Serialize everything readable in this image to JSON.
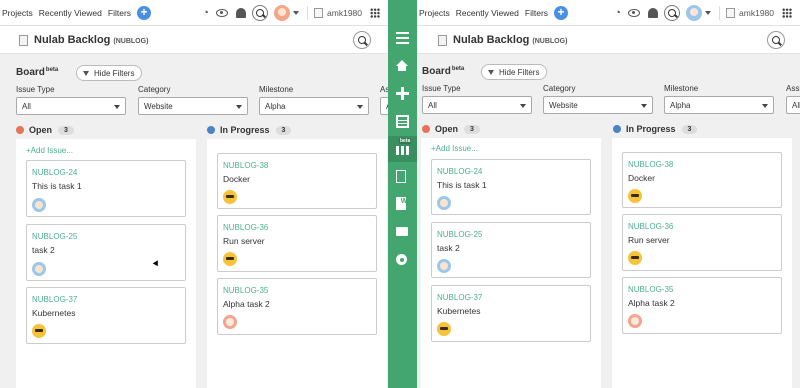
{
  "nav": {
    "projects": "Projects",
    "recently_viewed": "Recently Viewed",
    "filters": "Filters",
    "add": "+",
    "username": "amk1980"
  },
  "project": {
    "title": "Nulab Backlog",
    "key": "(NUBLOG)"
  },
  "board": {
    "title": "Board",
    "beta": "beta",
    "hide_filters": "Hide Filters"
  },
  "filters": {
    "issue_type": {
      "label": "Issue Type",
      "value": "All"
    },
    "category": {
      "label": "Category",
      "value": "Website"
    },
    "milestone": {
      "label": "Milestone",
      "value": "Alpha"
    },
    "assignee": {
      "label": "Assi",
      "value": "All"
    }
  },
  "columns": {
    "open": {
      "title": "Open",
      "count": "3",
      "color": "#e8735a",
      "add_issue": "+Add Issue..."
    },
    "in_progress": {
      "title": "In Progress",
      "count": "3",
      "color": "#4a84c4"
    }
  },
  "cards": {
    "open": [
      {
        "key": "NUBLOG-24",
        "summary": "This is task 1",
        "avatar": "blue-avatar"
      },
      {
        "key": "NUBLOG-25",
        "summary": "task 2",
        "avatar": "blue-avatar"
      },
      {
        "key": "NUBLOG-37",
        "summary": "Kubernetes",
        "avatar": "yellow-avatar"
      }
    ],
    "in_progress": [
      {
        "key": "NUBLOG-38",
        "summary": "Docker",
        "avatar": "yellow-avatar"
      },
      {
        "key": "NUBLOG-36",
        "summary": "Run server",
        "avatar": "yellow-avatar"
      },
      {
        "key": "NUBLOG-35",
        "summary": "Alpha task 2",
        "avatar": "pink-avatar"
      }
    ]
  },
  "sidebar": {
    "beta_badge": "beta",
    "wiki_letter": "W",
    "accent": "#42a66e"
  }
}
